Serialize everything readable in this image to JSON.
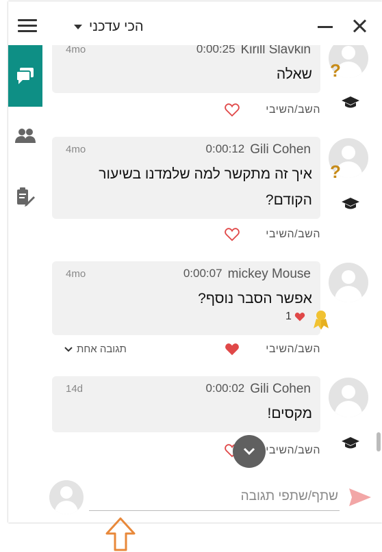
{
  "header": {
    "sort_label": "הכי עדכני",
    "menu_icon": "hamburger-icon",
    "caret_icon": "caret-down-icon",
    "minimize_icon": "minimize-icon",
    "close_icon": "close-icon"
  },
  "nav": [
    {
      "name": "discussion",
      "icon": "chat-bubbles-icon",
      "active": true
    },
    {
      "name": "participants",
      "icon": "people-icon",
      "active": false
    },
    {
      "name": "notes",
      "icon": "clipboard-edit-icon",
      "active": false
    }
  ],
  "comments": [
    {
      "author": "Kirill Slavkin",
      "time": "0:00:25",
      "ago": "4mo",
      "text": "שאלה",
      "badges": [
        "question-icon",
        "graduation-cap-icon"
      ],
      "reply_label": "השב/השיבי",
      "liked": false
    },
    {
      "author": "Gili Cohen",
      "time": "0:00:12",
      "ago": "4mo",
      "text": "איך זה מתקשר למה שלמדנו בשיעור הקודם?",
      "badges": [
        "question-icon",
        "graduation-cap-icon"
      ],
      "reply_label": "השב/השיבי",
      "liked": false
    },
    {
      "author": "mickey Mouse",
      "time": "0:00:07",
      "ago": "4mo",
      "text": "אפשר הסבר נוסף?",
      "likes_count": "1",
      "badges": [
        "award-icon"
      ],
      "reply_label": "השב/השיבי",
      "liked": true,
      "replies_label": "תגובה אחת"
    },
    {
      "author": "Gili Cohen",
      "time": "0:00:02",
      "ago": "14d",
      "text": "מקסים!",
      "badges": [
        "graduation-cap-icon"
      ],
      "reply_label": "השב/השיבי",
      "liked": false
    }
  ],
  "composer": {
    "placeholder": "שתף/שתפי תגובה",
    "send_icon": "send-icon"
  },
  "colors": {
    "accent": "#0e8f85",
    "heart": "#e04848",
    "badge_gold": "#c68a17",
    "send": "#f2a6a6",
    "arrow": "#e8883a"
  }
}
